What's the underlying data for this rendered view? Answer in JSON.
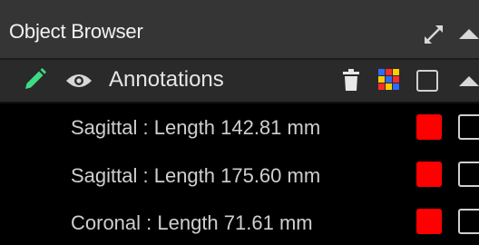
{
  "panel": {
    "title": "Object Browser",
    "icons": {
      "expand": "expand-arrows-icon",
      "collapse": "caret-up-icon"
    }
  },
  "group": {
    "label": "Annotations",
    "icons": {
      "edit": "pencil-icon",
      "visibility": "eye-icon",
      "delete": "trash-icon",
      "color": "color-palette-icon",
      "collapse": "caret-up-icon"
    },
    "checked": false
  },
  "items": [
    {
      "label": "Sagittal : Length 142.81 mm",
      "color": "#ff0000",
      "checked": false
    },
    {
      "label": "Sagittal : Length 175.60 mm",
      "color": "#ff0000",
      "checked": false
    },
    {
      "label": "Coronal : Length 71.61 mm",
      "color": "#ff0000",
      "checked": false
    }
  ],
  "colors": {
    "titlebar_bg": "#353535",
    "group_bg": "#2a2a2a",
    "list_bg": "#000000",
    "pencil": "#3ddc84",
    "annotation": "#ff0000"
  }
}
